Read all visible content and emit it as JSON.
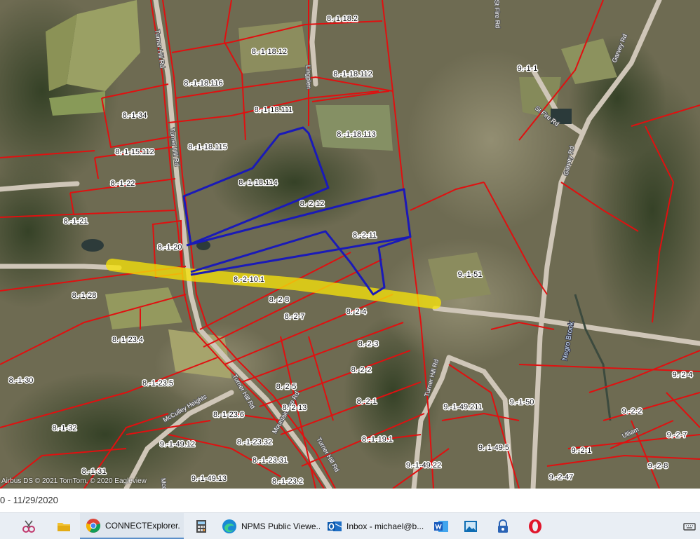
{
  "map": {
    "parcels": [
      {
        "id": "p1",
        "label": "8.-1-18.2"
      },
      {
        "id": "p2",
        "label": "8.-1-18.12"
      },
      {
        "id": "p3",
        "label": "8.-1-18.112"
      },
      {
        "id": "p4",
        "label": "8.-1-18.116"
      },
      {
        "id": "p5",
        "label": "8.-1-18.111"
      },
      {
        "id": "p6",
        "label": "8.-1-18.113"
      },
      {
        "id": "p7",
        "label": "8.-1-34"
      },
      {
        "id": "p8",
        "label": "8.-1-18.115"
      },
      {
        "id": "p9",
        "label": "8.-1-15.112"
      },
      {
        "id": "p10",
        "label": "8.-1-22"
      },
      {
        "id": "p11",
        "label": "8.-1-18.114"
      },
      {
        "id": "p12",
        "label": "8.-2-12"
      },
      {
        "id": "p13",
        "label": "8.-1-21"
      },
      {
        "id": "p14",
        "label": "8.-2-11"
      },
      {
        "id": "p15",
        "label": "8.-1-20"
      },
      {
        "id": "p16",
        "label": "8.-2-10.1"
      },
      {
        "id": "p17",
        "label": "8.-1-28"
      },
      {
        "id": "p18",
        "label": "8.-2-8"
      },
      {
        "id": "p19",
        "label": "8.-2-7"
      },
      {
        "id": "p20",
        "label": "8.-2-4"
      },
      {
        "id": "p21",
        "label": "8.-1-23.4"
      },
      {
        "id": "p22",
        "label": "8.-2-3"
      },
      {
        "id": "p23",
        "label": "8.-2-2"
      },
      {
        "id": "p24",
        "label": "8.-1-30"
      },
      {
        "id": "p25",
        "label": "8.-1-23.5"
      },
      {
        "id": "p26",
        "label": "8.-2-5"
      },
      {
        "id": "p27",
        "label": "8.-2-13"
      },
      {
        "id": "p28",
        "label": "8.-2-1"
      },
      {
        "id": "p29",
        "label": "8.-1-32"
      },
      {
        "id": "p30",
        "label": "8.-1-23.6"
      },
      {
        "id": "p31",
        "label": "9.-1-49.12"
      },
      {
        "id": "p32",
        "label": "8.-1-23.32"
      },
      {
        "id": "p33",
        "label": "8.-1-19.1"
      },
      {
        "id": "p34",
        "label": "8.-1-23.31"
      },
      {
        "id": "p35",
        "label": "8.-1-31"
      },
      {
        "id": "p36",
        "label": "9.-1-49.13"
      },
      {
        "id": "p37",
        "label": "8.-1-23.2"
      },
      {
        "id": "p38",
        "label": "9.-1-1"
      },
      {
        "id": "p39",
        "label": "9.-1-51"
      },
      {
        "id": "p40",
        "label": "9.-1-49.211"
      },
      {
        "id": "p41",
        "label": "9.-1-50"
      },
      {
        "id": "p42",
        "label": "9.-1-49.5"
      },
      {
        "id": "p43",
        "label": "9.-1-49.22"
      },
      {
        "id": "p44",
        "label": "9.-2-4"
      },
      {
        "id": "p45",
        "label": "9.-2-2"
      },
      {
        "id": "p46",
        "label": "9.-2-7"
      },
      {
        "id": "p47",
        "label": "9.-2-1"
      },
      {
        "id": "p48",
        "label": "9.-2-8"
      },
      {
        "id": "p49",
        "label": "9.-2-47"
      }
    ],
    "roads": [
      {
        "id": "r1",
        "label": "Turner Hill Rd"
      },
      {
        "id": "r2",
        "label": "Turner Hill Rd"
      },
      {
        "id": "r3",
        "label": "Turner Hill Rd"
      },
      {
        "id": "r4",
        "label": "Turner Hill Rd"
      },
      {
        "id": "r5",
        "label": "Turner Hill Rd"
      },
      {
        "id": "r6",
        "label": "Garvey Rd"
      },
      {
        "id": "r7",
        "label": "Garvey Rd"
      },
      {
        "id": "r8",
        "label": "St Fire Rd"
      },
      {
        "id": "r9",
        "label": "St Fire Rd"
      },
      {
        "id": "r10",
        "label": "McCulley Heights"
      },
      {
        "id": "r11",
        "label": "Mountain Top Rd"
      },
      {
        "id": "r12",
        "label": "Lingplen"
      },
      {
        "id": "r13",
        "label": "Mcculley"
      },
      {
        "id": "r14",
        "label": "Ulliam"
      }
    ],
    "water": {
      "brook": "Negro Brook"
    },
    "attribution": "Airbus DS © 2021 TomTom, © 2020 Eagleview",
    "colors": {
      "parcel_line": "#e01010",
      "highlight_outline": "#1a1ab8",
      "corridor": "#f5e20a",
      "aerial": "#6b6a4e"
    }
  },
  "date_bar": {
    "text": "0 - 11/29/2020"
  },
  "taskbar": {
    "items": [
      {
        "id": "t1",
        "icon": "snipping-tool-icon",
        "label": ""
      },
      {
        "id": "t2",
        "icon": "file-explorer-icon",
        "label": ""
      },
      {
        "id": "t3",
        "icon": "chrome-icon",
        "label": "CONNECTExplorer..."
      },
      {
        "id": "t4",
        "icon": "calculator-icon",
        "label": ""
      },
      {
        "id": "t5",
        "icon": "edge-icon",
        "label": "NPMS Public Viewe..."
      },
      {
        "id": "t6",
        "icon": "outlook-icon",
        "label": "Inbox - michael@b..."
      },
      {
        "id": "t7",
        "icon": "word-icon",
        "label": ""
      },
      {
        "id": "t8",
        "icon": "photos-icon",
        "label": ""
      },
      {
        "id": "t9",
        "icon": "lock-icon",
        "label": ""
      },
      {
        "id": "t10",
        "icon": "opera-icon",
        "label": ""
      },
      {
        "id": "t11",
        "icon": "keyboard-icon",
        "label": ""
      }
    ]
  }
}
